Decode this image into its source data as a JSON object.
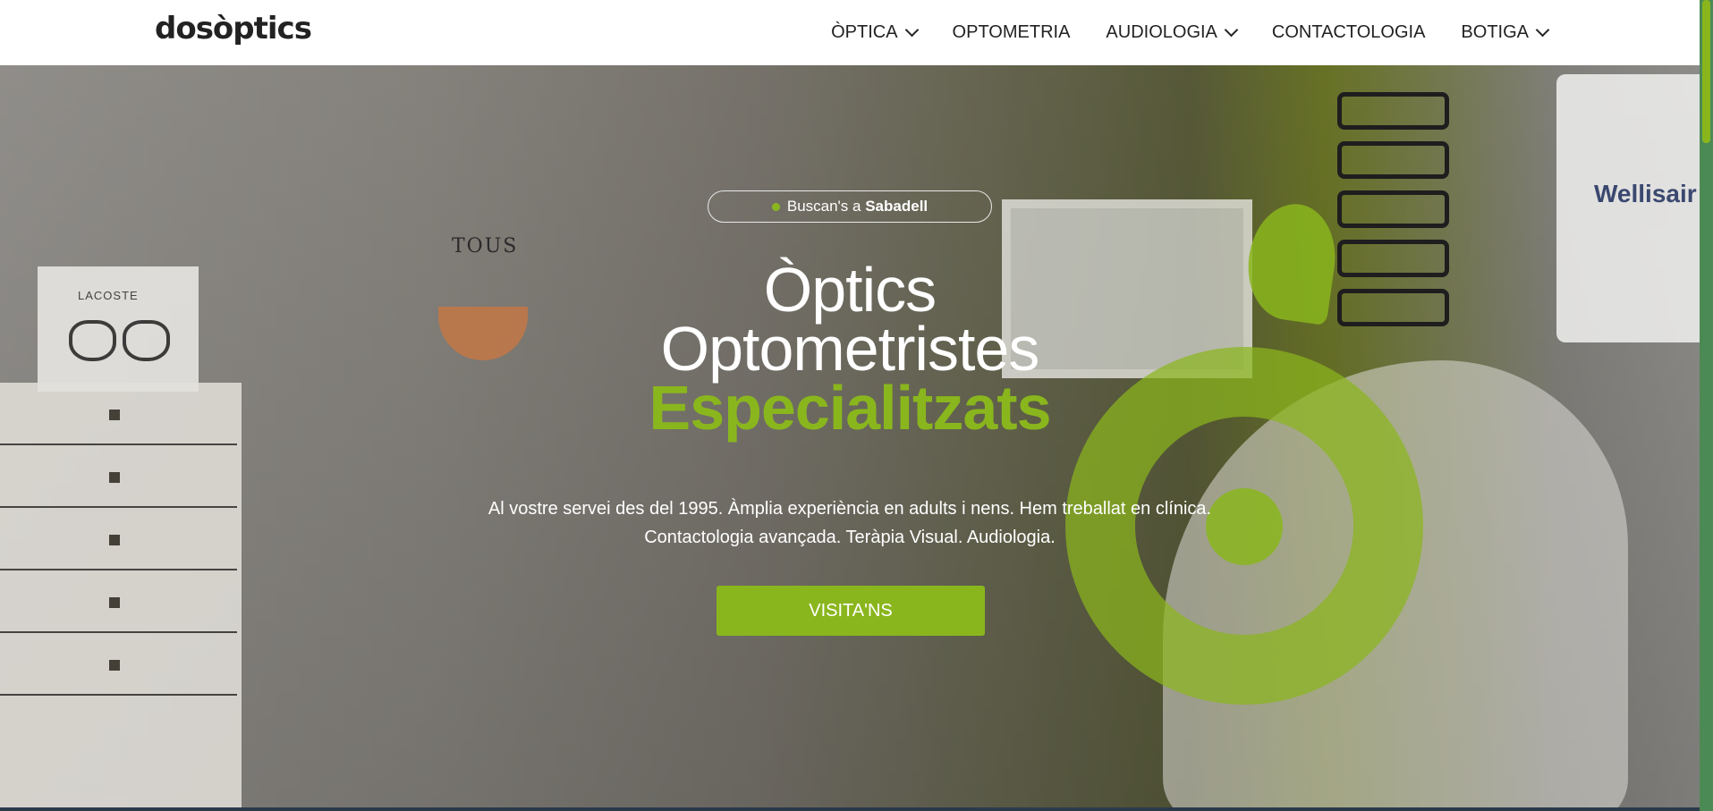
{
  "brand": {
    "logo_text": "dosòptics",
    "accent_color": "#8ab61d"
  },
  "nav": {
    "items": [
      {
        "label": "ÒPTICA",
        "has_dropdown": true
      },
      {
        "label": "OPTOMETRIA",
        "has_dropdown": false
      },
      {
        "label": "AUDIOLOGIA",
        "has_dropdown": true
      },
      {
        "label": "CONTACTOLOGIA",
        "has_dropdown": false
      },
      {
        "label": "BOTIGA",
        "has_dropdown": true
      }
    ]
  },
  "hero": {
    "location_pill": {
      "prefix": "Buscan's a ",
      "city": "Sabadell"
    },
    "title_line1": "Òptics",
    "title_line2": "Optometristes",
    "title_line3": "Especialitzats",
    "description_line1": "Al vostre servei des del 1995. Àmplia experiència en adults i nens. Hem treballat en clínica.",
    "description_line2": "Contactologia avançada. Teràpia Visual. Audiologia.",
    "cta_label": "VISITA'NS"
  },
  "background_signage": {
    "lacoste": "LACOSTE",
    "tous": "TOUS",
    "wellisair": "Wellisair"
  }
}
